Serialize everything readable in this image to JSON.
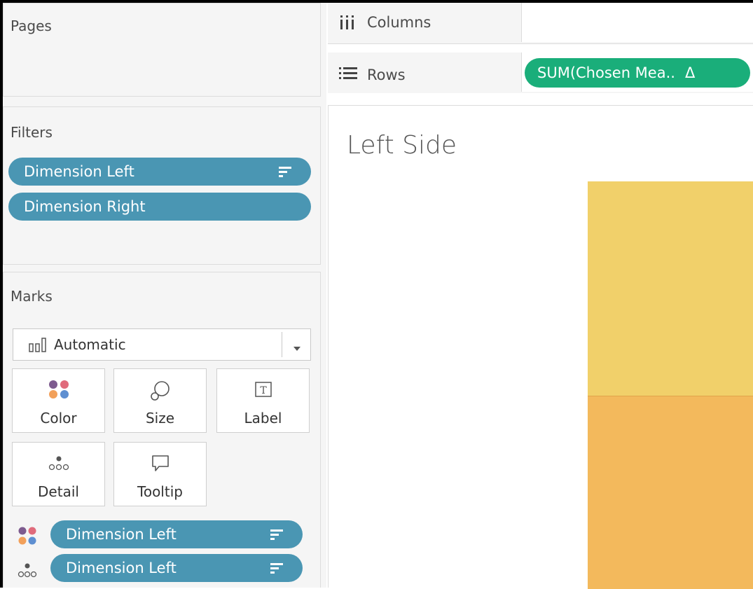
{
  "pages": {
    "title": "Pages"
  },
  "filters": {
    "title": "Filters",
    "items": [
      {
        "label": "Dimension Left",
        "sorted": true
      },
      {
        "label": "Dimension Right",
        "sorted": false
      }
    ]
  },
  "marks": {
    "title": "Marks",
    "type_value": "Automatic",
    "buttons": {
      "color": "Color",
      "size": "Size",
      "label": "Label",
      "detail": "Detail",
      "tooltip": "Tooltip"
    },
    "fields": [
      {
        "role": "color",
        "label": "Dimension Left"
      },
      {
        "role": "detail",
        "label": "Dimension Left"
      }
    ]
  },
  "shelves": {
    "columns_label": "Columns",
    "rows_label": "Rows",
    "rows_pill": "SUM(Chosen Mea..",
    "rows_pill_delta": "Δ"
  },
  "view": {
    "title": "Left Side",
    "colors": {
      "top": "#f1d06a",
      "bottom": "#f3b95c"
    }
  },
  "colors": {
    "pill_blue": "#4a96b3",
    "pill_green": "#1aae7a"
  }
}
